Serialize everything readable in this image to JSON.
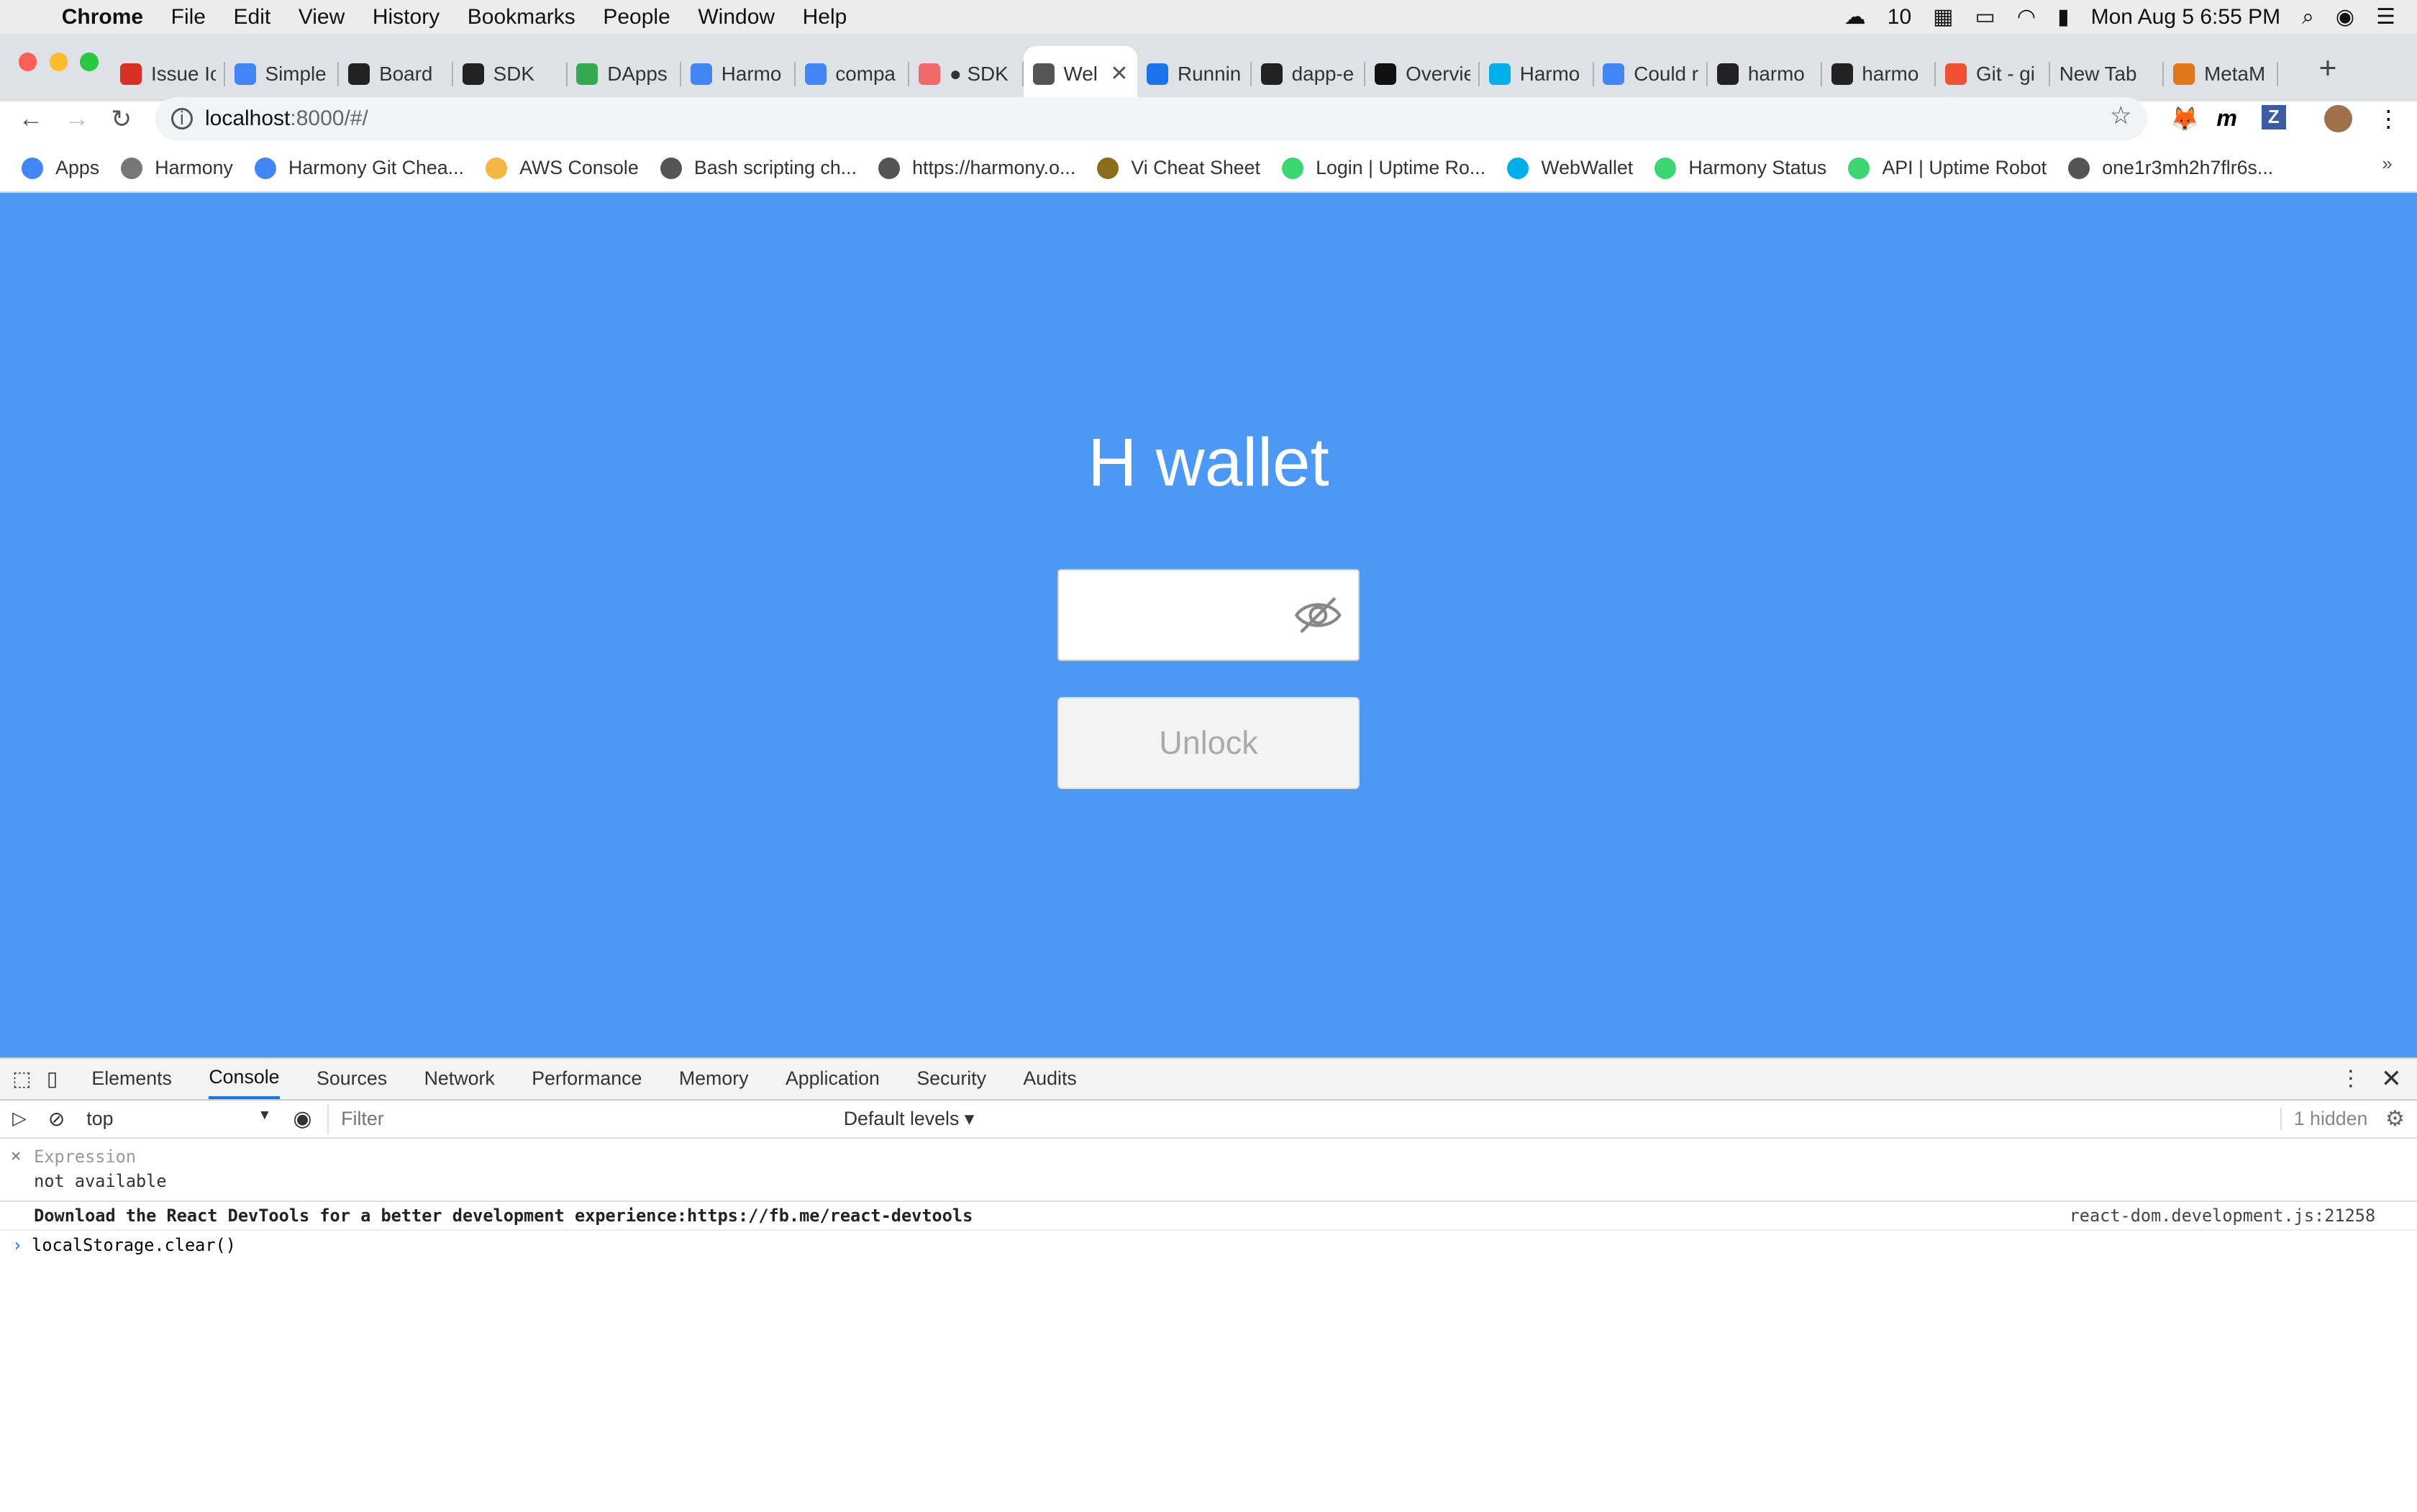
{
  "menubar": {
    "app_name": "Chrome",
    "items": [
      "File",
      "Edit",
      "View",
      "History",
      "Bookmarks",
      "People",
      "Window",
      "Help"
    ],
    "notification_count": "10",
    "datetime": "Mon Aug 5  6:55 PM"
  },
  "tabs": [
    {
      "label": "Issue Ic",
      "icon": "gmail-icon",
      "color": "#d93025"
    },
    {
      "label": "Simple",
      "icon": "calendar-icon",
      "color": "#4285f4"
    },
    {
      "label": "Board",
      "icon": "github-icon",
      "color": "#222222"
    },
    {
      "label": "SDK",
      "icon": "github-icon",
      "color": "#222222"
    },
    {
      "label": "DApps",
      "icon": "drive-icon",
      "color": "#34a853"
    },
    {
      "label": "Harmo",
      "icon": "docs-icon",
      "color": "#4285f4"
    },
    {
      "label": "compa",
      "icon": "docs-icon",
      "color": "#4285f4"
    },
    {
      "label": "● SDK",
      "icon": "asana-icon",
      "color": "#f06a6a"
    },
    {
      "label": "Wel",
      "icon": "globe-icon",
      "color": "#555555",
      "active": true
    },
    {
      "label": "Runnin",
      "icon": "layers-icon",
      "color": "#1a73e8"
    },
    {
      "label": "dapp-e",
      "icon": "github-icon",
      "color": "#222222"
    },
    {
      "label": "Overvie",
      "icon": "notion-icon",
      "color": "#111111"
    },
    {
      "label": "Harmo",
      "icon": "harmony-icon",
      "color": "#00aee9"
    },
    {
      "label": "Could r",
      "icon": "google-icon",
      "color": "#4285f4"
    },
    {
      "label": "harmo",
      "icon": "github-icon",
      "color": "#222222"
    },
    {
      "label": "harmo",
      "icon": "github-icon",
      "color": "#222222"
    },
    {
      "label": "Git - gi",
      "icon": "git-icon",
      "color": "#f05133"
    },
    {
      "label": "New Tab",
      "icon": "",
      "color": ""
    },
    {
      "label": "MetaM",
      "icon": "metamask-icon",
      "color": "#e2761b"
    }
  ],
  "address": {
    "host": "localhost",
    "path": ":8000/#/"
  },
  "bookmarks": [
    {
      "label": "Apps",
      "color": "#4285f4"
    },
    {
      "label": "Harmony",
      "color": "#777777"
    },
    {
      "label": "Harmony Git Chea...",
      "color": "#4285f4"
    },
    {
      "label": "AWS Console",
      "color": "#f5b642"
    },
    {
      "label": "Bash scripting ch...",
      "color": "#555555"
    },
    {
      "label": "https://harmony.o...",
      "color": "#555555"
    },
    {
      "label": "Vi Cheat Sheet",
      "color": "#8a6d1e"
    },
    {
      "label": "Login | Uptime Ro...",
      "color": "#3bd671"
    },
    {
      "label": "WebWallet",
      "color": "#00aee9"
    },
    {
      "label": "Harmony Status",
      "color": "#3bd671"
    },
    {
      "label": "API | Uptime Robot",
      "color": "#3bd671"
    },
    {
      "label": "one1r3mh2h7flr6s...",
      "color": "#555555"
    }
  ],
  "page": {
    "title": "H wallet",
    "unlock_label": "Unlock",
    "bg_color": "#4c98f5"
  },
  "devtools": {
    "tabs": [
      "Elements",
      "Console",
      "Sources",
      "Network",
      "Performance",
      "Memory",
      "Application",
      "Security",
      "Audits"
    ],
    "active_tab": "Console",
    "context": "top",
    "filter_placeholder": "Filter",
    "levels": "Default levels ▾",
    "hidden": "1 hidden",
    "expression_label": "Expression",
    "expression_value": "not available",
    "message_text": "Download the React DevTools for a better development experience: ",
    "message_link": "https://fb.me/react-devtools",
    "message_source": "react-dom.development.js:21258",
    "prompt_input": "localStorage.clear()"
  }
}
